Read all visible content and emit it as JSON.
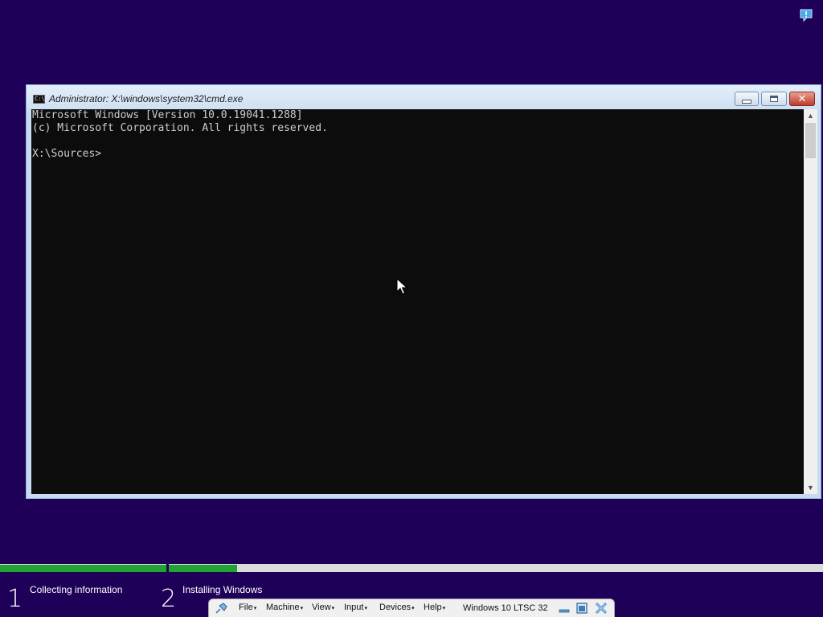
{
  "notification": {
    "icon": "feedback-icon"
  },
  "cmd": {
    "title": "Administrator: X:\\windows\\system32\\cmd.exe",
    "icon_text": "C:\\",
    "lines": [
      "Microsoft Windows [Version 10.0.19041.1288]",
      "(c) Microsoft Corporation. All rights reserved.",
      "",
      "X:\\Sources>"
    ],
    "scroll_up_glyph": "▲",
    "scroll_down_glyph": "▼",
    "close_glyph": "✕"
  },
  "setup": {
    "steps": [
      {
        "number": "1",
        "label": "Collecting information"
      },
      {
        "number": "2",
        "label": "Installing Windows"
      }
    ],
    "colors": {
      "background": "#1e0058",
      "progress": "#21a336",
      "track": "#dcdcdc"
    },
    "step1_progress": 1.0,
    "step2_progress": 0.105
  },
  "vbox": {
    "menus": [
      "File",
      "Machine",
      "View",
      "Input",
      "Devices",
      "Help"
    ],
    "menu_arrow": "▾",
    "vm_name": "Windows 10 LTSC 32"
  }
}
